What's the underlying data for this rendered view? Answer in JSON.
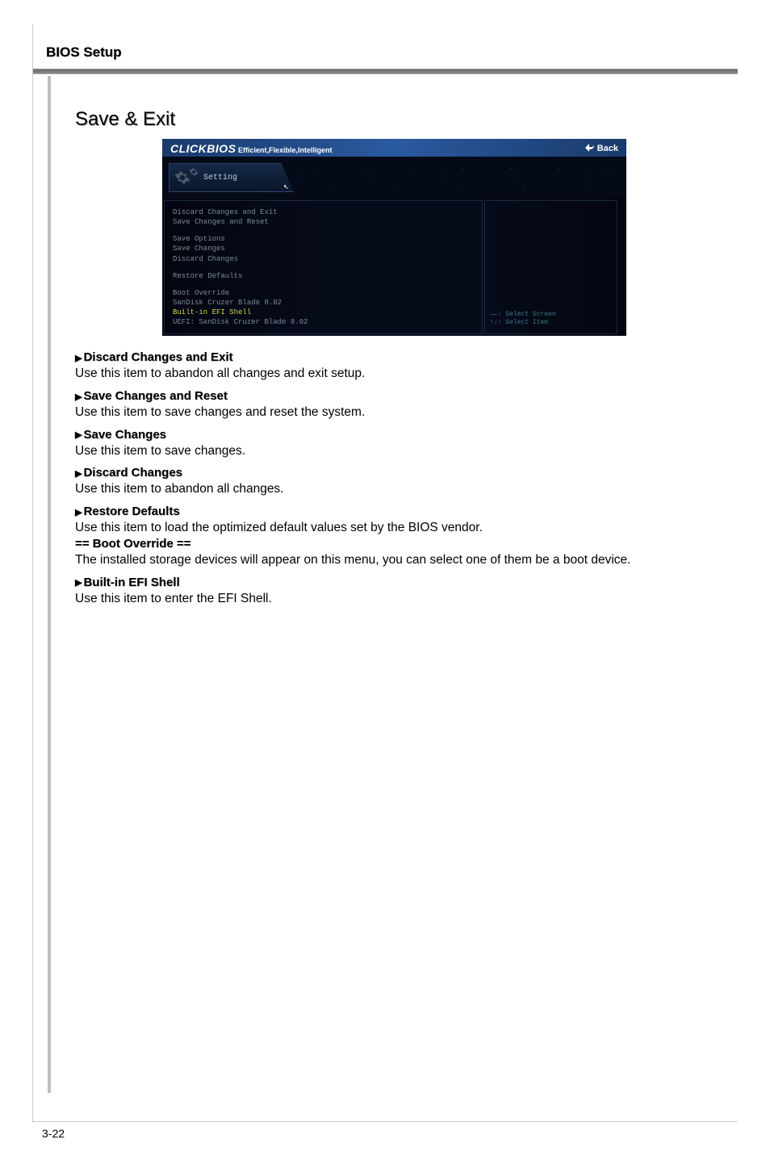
{
  "header": {
    "title": "BIOS Setup"
  },
  "section": {
    "title": "Save & Exit"
  },
  "bios": {
    "logo": "CLICKBIOS",
    "tagline": "Efficient,Flexible,Intelligent",
    "back": "Back",
    "setting_tab": "Setting",
    "menu": {
      "discard_exit": "Discard Changes and Exit",
      "save_reset": "Save Changes and Reset",
      "save_options": "Save Options",
      "save_changes": "Save Changes",
      "discard_changes": "Discard Changes",
      "restore_defaults": "Restore Defaults",
      "boot_override": "Boot Override",
      "sandisk": "SanDisk Cruzer Blade 8.02",
      "efi_shell": "Built-in EFI Shell",
      "uefi_sandisk": "UEFI: SanDisk Cruzer Blade 8.02"
    },
    "help": {
      "select_screen": "→←: Select Screen",
      "select_item": "↑↓: Select Item"
    }
  },
  "items": [
    {
      "title": "Discard Changes and Exit",
      "desc": "Use this item to abandon all changes and exit setup.",
      "arrow": true
    },
    {
      "title": "Save Changes and Reset",
      "desc": "Use this item to save changes and reset the system.",
      "arrow": true
    },
    {
      "title": "Save Changes",
      "desc": "Use this item to save changes.",
      "arrow": true
    },
    {
      "title": "Discard Changes",
      "desc": "Use this item to abandon all changes.",
      "arrow": true
    },
    {
      "title": "Restore Defaults",
      "desc": "Use this item to load the optimized default values set by the BIOS vendor.",
      "arrow": true
    },
    {
      "title": "== Boot Override ==",
      "desc": "The installed storage devices will appear on this menu, you can select one of them be a boot device.",
      "arrow": false
    },
    {
      "title": "Built-in EFI Shell",
      "desc": "Use this item to enter the EFI Shell.",
      "arrow": true
    }
  ],
  "footer": {
    "page": "3-22"
  }
}
